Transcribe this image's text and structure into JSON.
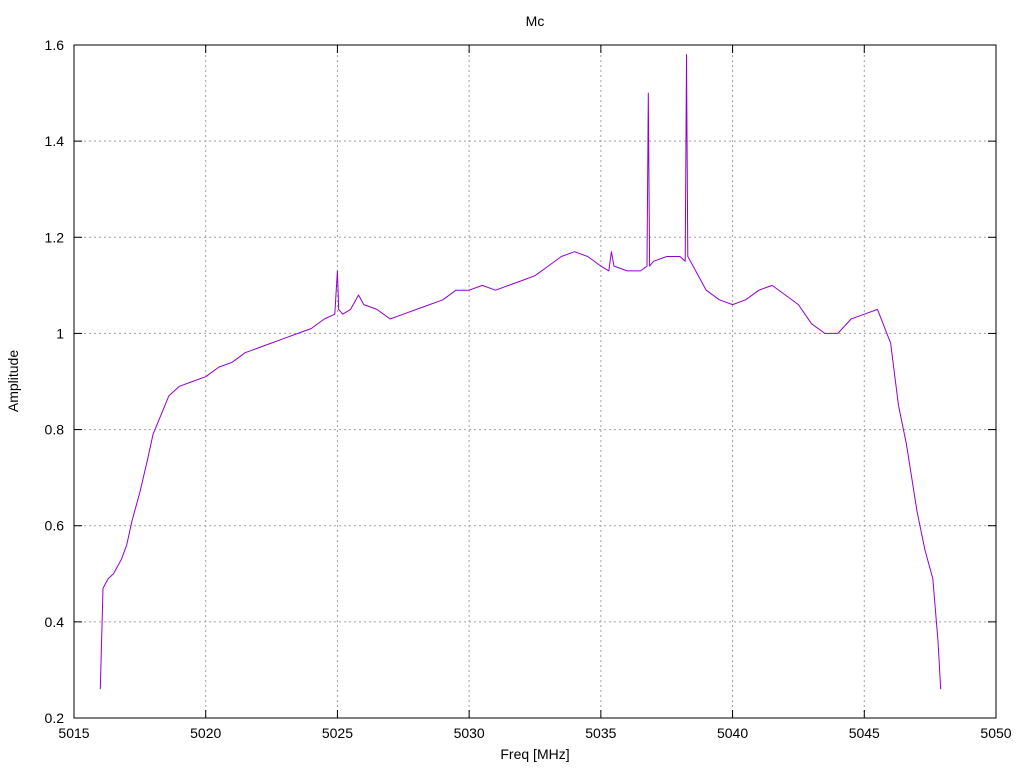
{
  "chart_data": {
    "type": "line",
    "title": "Mc",
    "xlabel": "Freq [MHz]",
    "ylabel": "Amplitude",
    "xlim": [
      5015,
      5050
    ],
    "ylim": [
      0.2,
      1.6
    ],
    "xticks": [
      5015,
      5020,
      5025,
      5030,
      5035,
      5040,
      5045,
      5050
    ],
    "yticks": [
      0.2,
      0.4,
      0.6,
      0.8,
      1,
      1.2,
      1.4,
      1.6
    ],
    "xtick_labels": [
      "5015",
      "5020",
      "5025",
      "5030",
      "5035",
      "5040",
      "5045",
      "5050"
    ],
    "ytick_labels": [
      "0.2",
      "0.4",
      "0.6",
      "0.8",
      "1",
      "1.2",
      "1.4",
      "1.6"
    ],
    "grid": true,
    "legend": "none",
    "series": [
      {
        "color": "#9400d3",
        "x": [
          5016.0,
          5016.1,
          5016.2,
          5016.3,
          5016.5,
          5016.8,
          5017.0,
          5017.2,
          5017.5,
          5017.8,
          5018.0,
          5018.3,
          5018.6,
          5018.8,
          5019.0,
          5019.5,
          5020.0,
          5020.5,
          5021.0,
          5021.5,
          5022.0,
          5022.5,
          5023.0,
          5023.5,
          5024.0,
          5024.5,
          5024.9,
          5025.0,
          5025.05,
          5025.2,
          5025.5,
          5025.8,
          5026.0,
          5026.5,
          5027.0,
          5027.5,
          5028.0,
          5028.5,
          5029.0,
          5029.5,
          5030.0,
          5030.5,
          5031.0,
          5031.5,
          5032.0,
          5032.5,
          5033.0,
          5033.5,
          5034.0,
          5034.5,
          5035.0,
          5035.3,
          5035.4,
          5035.5,
          5036.0,
          5036.5,
          5036.75,
          5036.8,
          5036.85,
          5037.0,
          5037.5,
          5038.0,
          5038.2,
          5038.25,
          5038.3,
          5038.5,
          5039.0,
          5039.5,
          5040.0,
          5040.5,
          5041.0,
          5041.5,
          5042.0,
          5042.5,
          5043.0,
          5043.5,
          5044.0,
          5044.5,
          5045.0,
          5045.5,
          5046.0,
          5046.3,
          5046.6,
          5047.0,
          5047.3,
          5047.6,
          5047.8,
          5047.9
        ],
        "y": [
          0.26,
          0.47,
          0.48,
          0.49,
          0.5,
          0.53,
          0.56,
          0.61,
          0.67,
          0.74,
          0.79,
          0.83,
          0.87,
          0.88,
          0.89,
          0.9,
          0.91,
          0.93,
          0.94,
          0.96,
          0.97,
          0.98,
          0.99,
          1.0,
          1.01,
          1.03,
          1.04,
          1.13,
          1.05,
          1.04,
          1.05,
          1.08,
          1.06,
          1.05,
          1.03,
          1.04,
          1.05,
          1.06,
          1.07,
          1.09,
          1.09,
          1.1,
          1.09,
          1.1,
          1.11,
          1.12,
          1.14,
          1.16,
          1.17,
          1.16,
          1.14,
          1.13,
          1.17,
          1.14,
          1.13,
          1.13,
          1.14,
          1.5,
          1.14,
          1.15,
          1.16,
          1.16,
          1.15,
          1.58,
          1.16,
          1.14,
          1.09,
          1.07,
          1.06,
          1.07,
          1.09,
          1.1,
          1.08,
          1.06,
          1.02,
          1.0,
          1.0,
          1.03,
          1.04,
          1.05,
          0.98,
          0.85,
          0.77,
          0.63,
          0.55,
          0.49,
          0.36,
          0.26
        ]
      }
    ]
  }
}
